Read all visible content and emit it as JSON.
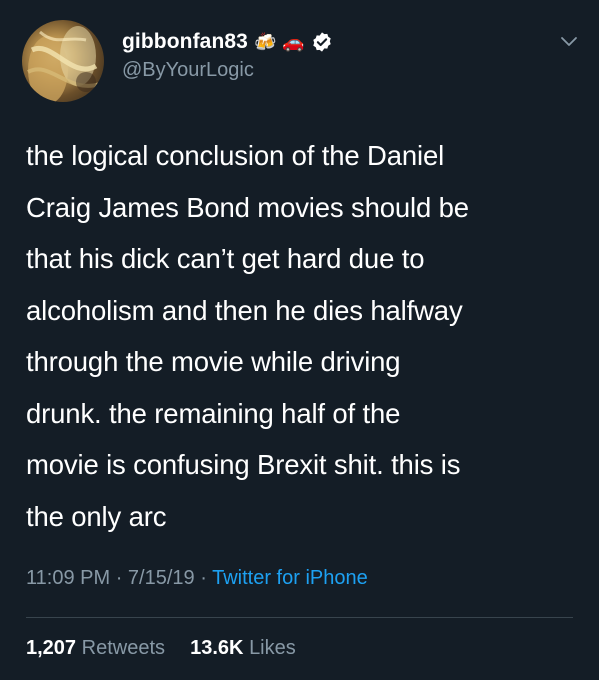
{
  "tweet": {
    "display_name": "gibbonfan83",
    "emojis": [
      "🍻",
      "🚗"
    ],
    "handle": "@ByYourLogic",
    "text": "the logical conclusion of the Daniel\nCraig James Bond movies should be\nthat his dick can’t get hard due to\nalcoholism and then he dies halfway\nthrough the movie while driving\ndrunk. the remaining half of the\nmovie is confusing Brexit shit. this is\nthe only arc",
    "time": "11:09 PM",
    "date": "7/15/19",
    "separator": "·",
    "source": "Twitter for iPhone",
    "retweet_count": "1,207",
    "retweet_label": "Retweets",
    "like_count": "13.6K",
    "like_label": "Likes"
  },
  "icons": {
    "verified": "verified-badge-icon",
    "chevron": "chevron-down-icon"
  },
  "colors": {
    "background": "#141d26",
    "text": "#ffffff",
    "secondary": "#8899a6",
    "link": "#1da1f2",
    "divider": "#38444d"
  }
}
